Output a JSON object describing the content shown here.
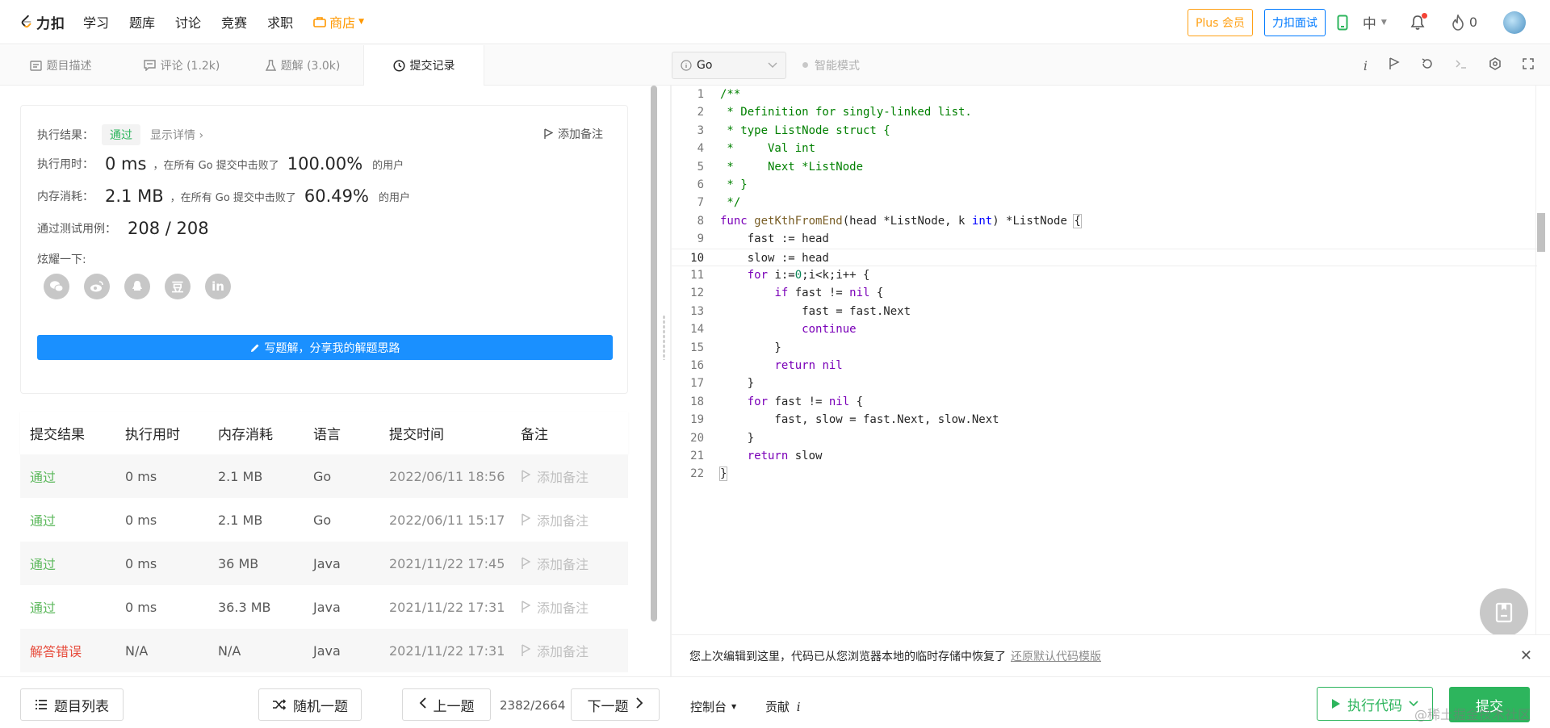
{
  "topnav": {
    "logo_text": "力扣",
    "items": [
      "学习",
      "题库",
      "讨论",
      "竞赛",
      "求职"
    ],
    "store": "商店",
    "plus_button": "Plus 会员",
    "interview_button": "力扣面试",
    "language": "中",
    "points": "0"
  },
  "left_tabs": [
    {
      "label": "题目描述",
      "icon": "document-icon"
    },
    {
      "label": "评论 (1.2k)",
      "icon": "comment-icon"
    },
    {
      "label": "题解 (3.0k)",
      "icon": "flask-icon"
    },
    {
      "label": "提交记录",
      "icon": "clock-icon"
    }
  ],
  "result": {
    "result_label": "执行结果：",
    "result_status": "通过",
    "show_details": "显示详情 ›",
    "add_note": "添加备注",
    "time_label": "执行用时：",
    "time_value": "0 ms",
    "time_text": "，在所有 Go 提交中击败了",
    "time_pct": "100.00%",
    "time_users": "的用户",
    "mem_label": "内存消耗：",
    "mem_value": "2.1 MB",
    "mem_text": "，在所有 Go 提交中击败了",
    "mem_pct": "60.49%",
    "mem_users": "的用户",
    "cases_label": "通过测试用例：",
    "cases_value": "208 / 208",
    "share_label": "炫耀一下:",
    "share_icons": [
      "wechat-icon",
      "weibo-icon",
      "qq-icon",
      "douban-icon",
      "linkedin-icon"
    ],
    "write_solution": "写题解，分享我的解题思路"
  },
  "submissions": {
    "headers": [
      "提交结果",
      "执行用时",
      "内存消耗",
      "语言",
      "提交时间",
      "备注"
    ],
    "rows": [
      {
        "status": "通过",
        "time": "0 ms",
        "memory": "2.1 MB",
        "lang": "Go",
        "submitted": "2022/06/11 18:56",
        "note": "添加备注"
      },
      {
        "status": "通过",
        "time": "0 ms",
        "memory": "2.1 MB",
        "lang": "Go",
        "submitted": "2022/06/11 15:17",
        "note": "添加备注"
      },
      {
        "status": "通过",
        "time": "0 ms",
        "memory": "36 MB",
        "lang": "Java",
        "submitted": "2021/11/22 17:45",
        "note": "添加备注"
      },
      {
        "status": "通过",
        "time": "0 ms",
        "memory": "36.3 MB",
        "lang": "Java",
        "submitted": "2021/11/22 17:31",
        "note": "添加备注"
      },
      {
        "status": "解答错误",
        "time": "N/A",
        "memory": "N/A",
        "lang": "Java",
        "submitted": "2021/11/22 17:31",
        "note": "添加备注"
      }
    ]
  },
  "editor": {
    "language": "Go",
    "smart_mode": "智能模式",
    "current_line": 10,
    "lines": [
      [
        [
          "cm",
          "/**"
        ]
      ],
      [
        [
          "cm",
          " * Definition for singly-linked list."
        ]
      ],
      [
        [
          "cm",
          " * type ListNode struct {"
        ]
      ],
      [
        [
          "cm",
          " *     Val int"
        ]
      ],
      [
        [
          "cm",
          " *     Next *ListNode"
        ]
      ],
      [
        [
          "cm",
          " * }"
        ]
      ],
      [
        [
          "cm",
          " */"
        ]
      ],
      [
        [
          "kw",
          "func "
        ],
        [
          "fn",
          "getKthFromEnd"
        ],
        [
          "",
          "(head *ListNode, k "
        ],
        [
          "ty",
          "int"
        ],
        [
          "",
          ") *ListNode "
        ],
        [
          "br",
          "{"
        ]
      ],
      [
        [
          "",
          "    fast := head"
        ]
      ],
      [
        [
          "",
          "    slow := head"
        ]
      ],
      [
        [
          "",
          "    "
        ],
        [
          "kw",
          "for"
        ],
        [
          "",
          " i:="
        ],
        [
          "nu",
          "0"
        ],
        [
          "",
          ";i<k;i++ {"
        ]
      ],
      [
        [
          "",
          "        "
        ],
        [
          "kw",
          "if"
        ],
        [
          "",
          " fast != "
        ],
        [
          "kw",
          "nil"
        ],
        [
          "",
          " {"
        ]
      ],
      [
        [
          "",
          "            fast = fast.Next"
        ]
      ],
      [
        [
          "",
          "            "
        ],
        [
          "kw",
          "continue"
        ]
      ],
      [
        [
          "",
          "        }"
        ]
      ],
      [
        [
          "",
          "        "
        ],
        [
          "kw",
          "return"
        ],
        [
          "",
          " "
        ],
        [
          "kw",
          "nil"
        ]
      ],
      [
        [
          "",
          "    }"
        ]
      ],
      [
        [
          "",
          "    "
        ],
        [
          "kw",
          "for"
        ],
        [
          "",
          " fast != "
        ],
        [
          "kw",
          "nil"
        ],
        [
          "",
          " {"
        ]
      ],
      [
        [
          "",
          "        fast, slow = fast.Next, slow.Next"
        ]
      ],
      [
        [
          "",
          "    }"
        ]
      ],
      [
        [
          "",
          "    "
        ],
        [
          "kw",
          "return"
        ],
        [
          "",
          " slow"
        ]
      ],
      [
        [
          "br",
          "}"
        ]
      ]
    ]
  },
  "notice": {
    "text": "您上次编辑到这里，代码已从您浏览器本地的临时存储中恢复了",
    "link": "还原默认代码模版"
  },
  "bottom": {
    "problem_list": "题目列表",
    "random": "随机一题",
    "prev": "上一题",
    "page": "2382/2664",
    "next": "下一题",
    "console": "控制台",
    "contribute": "贡献",
    "run": "执行代码",
    "submit": "提交"
  },
  "watermark": "@稀土掘金技术社区",
  "colors": {
    "accent_green": "#2db55d",
    "accent_blue": "#1a90ff",
    "brand_orange": "#ffa116",
    "fail_red": "#e74c3c"
  }
}
